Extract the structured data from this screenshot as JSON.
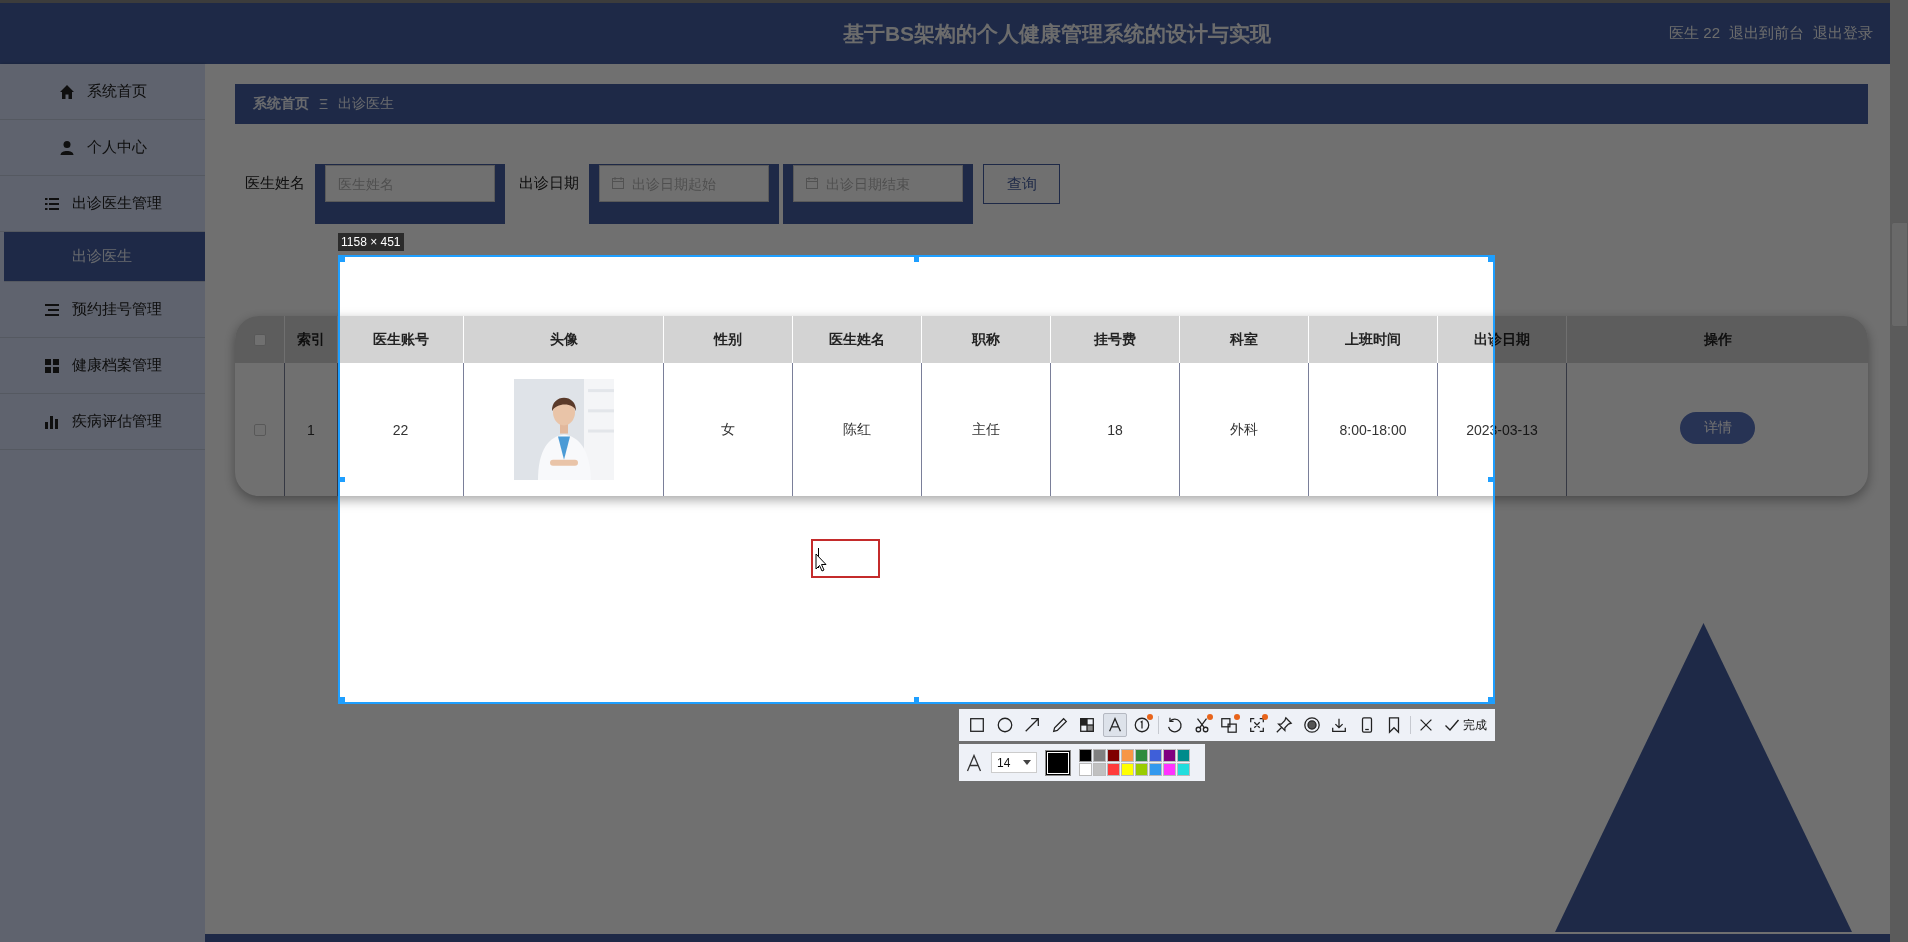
{
  "header": {
    "title": "基于BS架构的个人健康管理系统的设计与实现",
    "user": "医生 22",
    "links": [
      "退出到前台",
      "退出登录"
    ]
  },
  "sidebar": {
    "items": [
      {
        "label": "系统首页",
        "selected": false
      },
      {
        "label": "个人中心",
        "selected": false
      },
      {
        "label": "出诊医生管理",
        "selected": false,
        "expanded": true,
        "children": [
          {
            "label": "出诊医生",
            "selected": true
          }
        ]
      },
      {
        "label": "预约挂号管理",
        "selected": false
      },
      {
        "label": "健康档案管理",
        "selected": false
      },
      {
        "label": "疾病评估管理",
        "selected": false
      }
    ]
  },
  "breadcrumb": {
    "items": [
      "系统首页",
      "出诊医生"
    ],
    "separator": "Ξ"
  },
  "search": {
    "fields": [
      {
        "label": "医生姓名",
        "placeholder": "医生姓名",
        "kind": "text"
      },
      {
        "label": "出诊日期",
        "placeholder": "出诊日期起始",
        "kind": "date"
      },
      {
        "placeholder": "出诊日期结束",
        "kind": "date"
      }
    ],
    "button": "查询"
  },
  "table": {
    "header_checked": false,
    "columns": [
      "索引",
      "医生账号",
      "头像",
      "性别",
      "医生姓名",
      "职称",
      "挂号费",
      "科室",
      "上班时间",
      "出诊日期",
      "操作"
    ],
    "rows": [
      {
        "checked": false,
        "cells": [
          {
            "kind": "text",
            "text": "1"
          },
          {
            "kind": "text",
            "text": "22"
          },
          {
            "kind": "picture"
          },
          {
            "kind": "text",
            "text": "女"
          },
          {
            "kind": "text",
            "text": "陈红"
          },
          {
            "kind": "text",
            "text": "主任"
          },
          {
            "kind": "text",
            "text": "18"
          },
          {
            "kind": "text",
            "text": "外科"
          },
          {
            "kind": "text",
            "text": "8:00-18:00"
          },
          {
            "kind": "text",
            "text": "2023-03-13"
          },
          {
            "kind": "button",
            "text": "详情"
          }
        ]
      }
    ]
  },
  "capture": {
    "size_label": "1158 × 451",
    "tools": [
      {
        "kind": "tool",
        "selected": false,
        "badge": false
      },
      {
        "kind": "tool",
        "selected": false,
        "badge": false
      },
      {
        "kind": "tool",
        "selected": false,
        "badge": false
      },
      {
        "kind": "tool",
        "selected": false,
        "badge": false
      },
      {
        "kind": "tool",
        "selected": false,
        "badge": false
      },
      {
        "kind": "tool",
        "selected": true,
        "badge": false
      },
      {
        "kind": "tool",
        "selected": false,
        "badge": true
      },
      {
        "kind": "divider"
      },
      {
        "kind": "tool",
        "selected": false,
        "badge": false
      },
      {
        "kind": "tool",
        "selected": false,
        "badge": true
      },
      {
        "kind": "tool",
        "selected": false,
        "badge": true
      },
      {
        "kind": "tool",
        "selected": false,
        "badge": true
      },
      {
        "kind": "tool",
        "selected": false,
        "badge": false
      },
      {
        "kind": "tool",
        "selected": false,
        "badge": false
      },
      {
        "kind": "tool",
        "selected": false,
        "badge": false
      },
      {
        "kind": "tool",
        "selected": false,
        "badge": false
      },
      {
        "kind": "tool",
        "selected": false,
        "badge": false
      },
      {
        "kind": "divider"
      },
      {
        "kind": "tool",
        "selected": false,
        "badge": false
      }
    ],
    "done": "完成",
    "font_size": "14",
    "swatches": [
      {
        "color": "#000000",
        "selected": true
      },
      {
        "color": "#808080",
        "selected": false
      },
      {
        "color": "#800000",
        "selected": false
      },
      {
        "color": "#f79646",
        "selected": false
      },
      {
        "color": "#2e8b3e",
        "selected": false
      },
      {
        "color": "#3f5fd9",
        "selected": false
      },
      {
        "color": "#800080",
        "selected": false
      },
      {
        "color": "#008b8b",
        "selected": false
      },
      {
        "color": "#ffffff",
        "selected": false
      },
      {
        "color": "#c0c0c0",
        "selected": false
      },
      {
        "color": "#ff3b3b",
        "selected": false
      },
      {
        "color": "#ffff00",
        "selected": false
      },
      {
        "color": "#99cc00",
        "selected": false
      },
      {
        "color": "#3399ee",
        "selected": false
      },
      {
        "color": "#ff33ff",
        "selected": false
      },
      {
        "color": "#22dddd",
        "selected": false
      }
    ]
  }
}
